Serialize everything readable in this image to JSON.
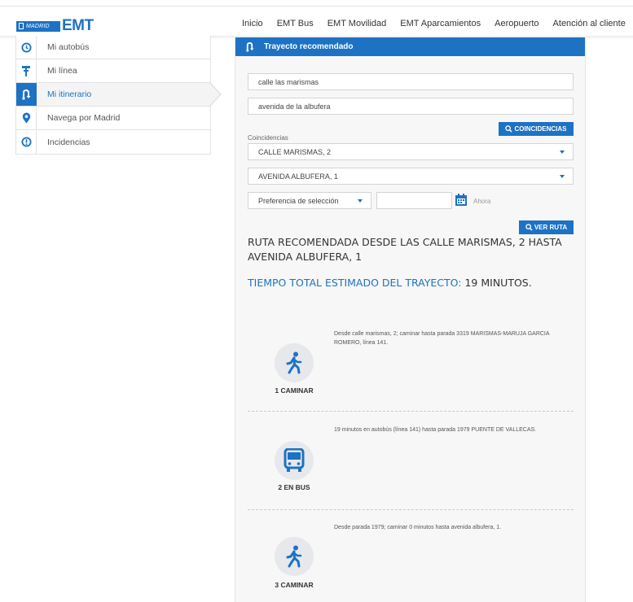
{
  "header": {
    "logo_small": "MADRID",
    "logo_text": "EMT",
    "nav": [
      "Inicio",
      "EMT Bus",
      "EMT Movilidad",
      "EMT Aparcamientos",
      "Aeropuerto",
      "Atención al cliente"
    ]
  },
  "sidebar": {
    "items": [
      {
        "label": "Mi autobús",
        "icon": "clock-icon"
      },
      {
        "label": "Mi línea",
        "icon": "bus-stop-icon"
      },
      {
        "label": "Mi itinerario",
        "icon": "route-icon",
        "active": true
      },
      {
        "label": "Navega por Madrid",
        "icon": "map-pin-icon"
      },
      {
        "label": "Incidencias",
        "icon": "alert-icon"
      }
    ]
  },
  "main": {
    "title": "Trayecto recomendado",
    "origin_value": "calle las marismas",
    "destination_value": "avenida de la albufera",
    "coincidencias_button": "COINCIDENCIAS",
    "coincidencias_label": "Coincidencias",
    "origin_select": "CALLE MARISMAS, 2",
    "destination_select": "AVENIDA ALBUFERA, 1",
    "preference_select": "Preferencia de selección",
    "ahora": "Ahora",
    "ver_ruta_button": "VER RUTA",
    "ruta_title": "RUTA RECOMENDADA DESDE LAS CALLE MARISMAS, 2 HASTA AVENIDA ALBUFERA, 1",
    "tiempo_label": "TIEMPO TOTAL ESTIMADO DEL TRAYECTO:",
    "tiempo_value": "19 MINUTOS."
  },
  "steps": [
    {
      "label": "1 CAMINAR",
      "icon": "walk-icon",
      "description": "Desde calle marismas, 2; caminar hasta parada 3319 MARISMAS-MARUJA GARCIA ROMERO, línea 141."
    },
    {
      "label": "2 EN BUS",
      "icon": "bus-icon",
      "description": "19 minutos en autobús (línea 141) hasta parada 1979 PUENTE DE VALLECAS."
    },
    {
      "label": "3 CAMINAR",
      "icon": "walk-icon",
      "description": "Desde parada 1979; caminar 0 minutos hasta avenida albufera, 1."
    }
  ],
  "colors": {
    "accent": "#1d72c4",
    "panel": "#f7f7f7"
  }
}
